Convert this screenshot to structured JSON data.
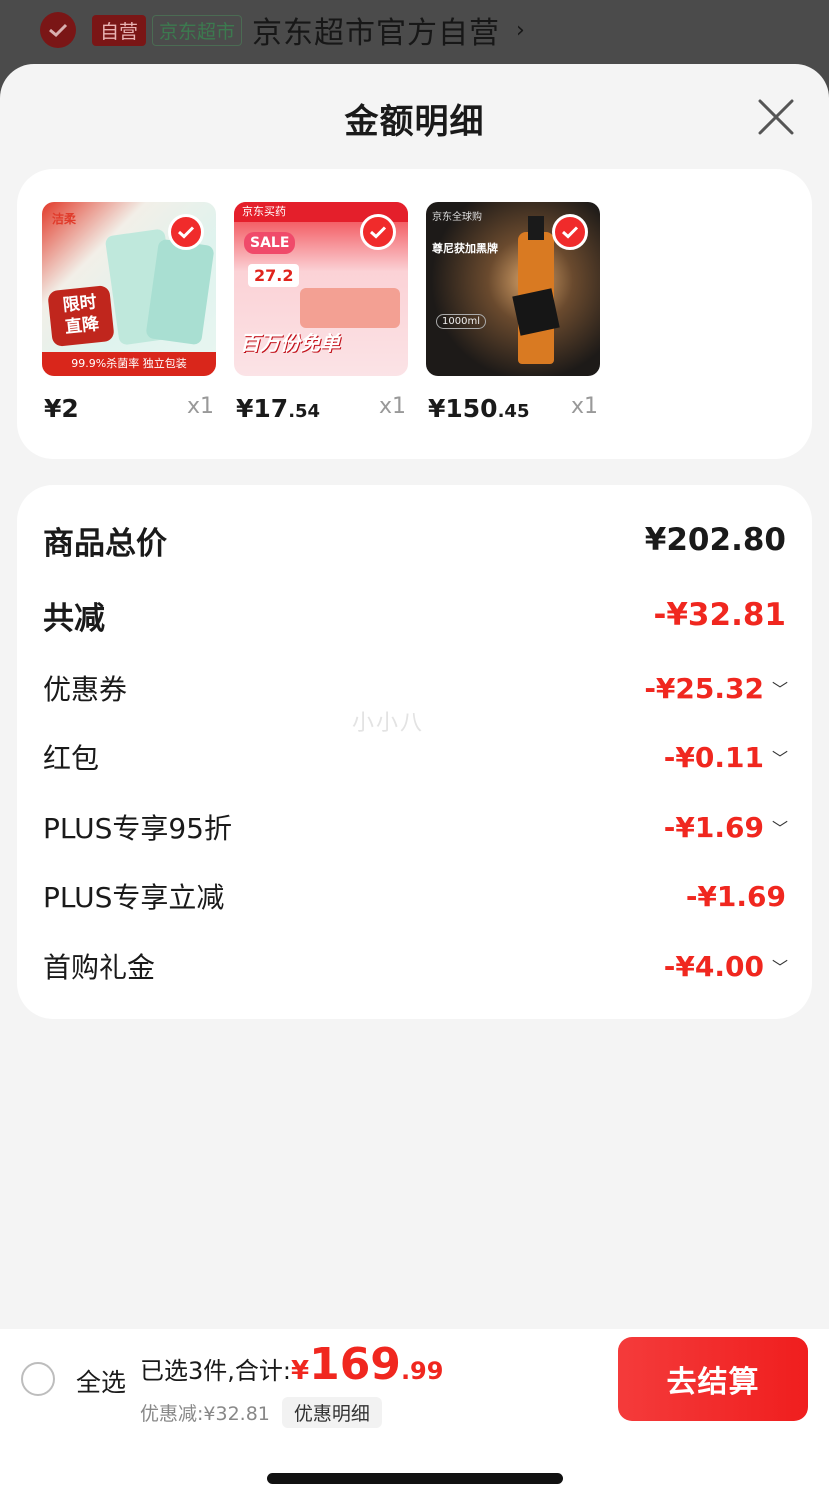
{
  "store": {
    "badge_self": "自营",
    "badge_market": "京东超市",
    "name": "京东超市官方自营",
    "arrow": "›"
  },
  "sheet": {
    "title": "金额明细",
    "close_icon": "close-icon"
  },
  "products": [
    {
      "price_int": "¥2",
      "price_dec": "",
      "qty": "x1",
      "img_text_a": "洁柔",
      "img_text_b": "限时直降",
      "img_text_c": "99.9%杀菌率 独立包装"
    },
    {
      "price_int": "¥17",
      "price_dec": ".54",
      "qty": "x1",
      "img_text_a": "京东买药",
      "img_text_b": "SALE",
      "img_text_c": "百万份免单",
      "img_text_d": "27.2"
    },
    {
      "price_int": "¥150",
      "price_dec": ".45",
      "qty": "x1",
      "img_text_a": "京东全球购",
      "img_text_b": "尊尼获加黑牌",
      "img_text_c": "1000ml"
    }
  ],
  "summary": {
    "total_label": "商品总价",
    "total_value": "¥202.80",
    "reduce_label": "共减",
    "reduce_value": "-¥32.81",
    "items": [
      {
        "label": "优惠券",
        "value": "-¥25.32",
        "expandable": true
      },
      {
        "label": "红包",
        "value": "-¥0.11",
        "expandable": true
      },
      {
        "label": "PLUS专享95折",
        "value": "-¥1.69",
        "expandable": true
      },
      {
        "label": "PLUS专享立减",
        "value": "-¥1.69",
        "expandable": false
      },
      {
        "label": "首购礼金",
        "value": "-¥4.00",
        "expandable": true
      }
    ],
    "watermark": "小小八"
  },
  "bottom": {
    "select_all": "全选",
    "selected_text": "已选3件,合计:",
    "currency": "¥",
    "total_int": "169",
    "total_dec": ".99",
    "discount_text": "优惠减:¥32.81",
    "detail_button": "优惠明细",
    "checkout_button": "去结算"
  },
  "colors": {
    "accent_red": "#f0271f",
    "background": "#f4f4f4"
  }
}
